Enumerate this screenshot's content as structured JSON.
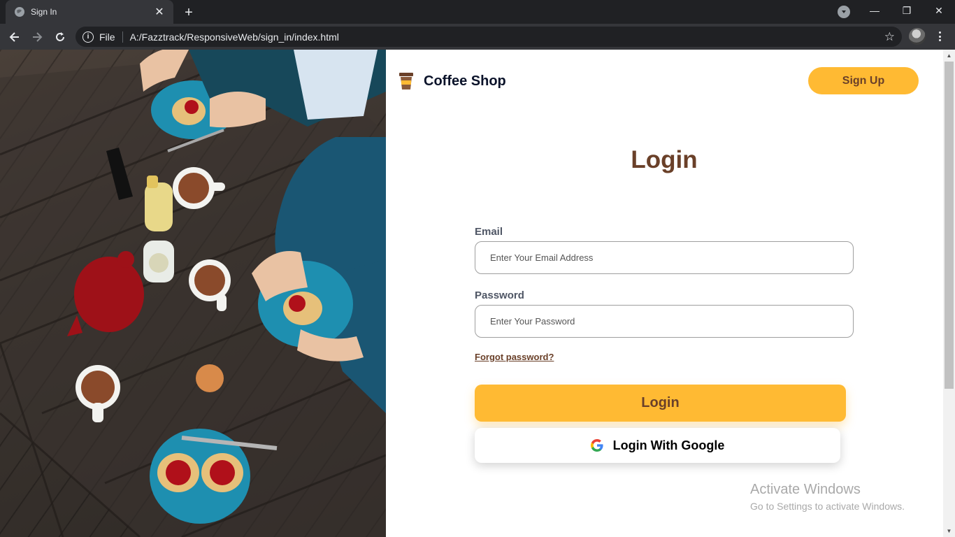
{
  "browser": {
    "tab_title": "Sign In",
    "tab_close": "✕",
    "new_tab": "+",
    "url_scheme": "File",
    "url": "A:/Fazztrack/ResponsiveWeb/sign_in/index.html",
    "window_minimize": "—",
    "window_restore": "❐",
    "window_close": "✕"
  },
  "page": {
    "brand_name": "Coffee Shop",
    "signup_label": "Sign Up",
    "title": "Login",
    "email_label": "Email",
    "email_placeholder": "Enter Your Email Address",
    "email_value": "",
    "password_label": "Password",
    "password_placeholder": "Enter Your Password",
    "password_value": "",
    "forgot_label": "Forgot password?",
    "login_label": "Login",
    "google_label": "Login With Google"
  },
  "watermark": {
    "title": "Activate Windows",
    "subtitle": "Go to Settings to activate Windows."
  },
  "colors": {
    "accent": "#ffba33",
    "brown": "#6a4029",
    "label": "#4f5665",
    "chrome_dark": "#202124",
    "chrome_mid": "#35363a"
  },
  "icons": {
    "favicon": "globe-icon",
    "back": "arrow-left-icon",
    "forward": "arrow-right-icon",
    "reload": "reload-icon",
    "info": "info-icon",
    "star": "star-icon",
    "brand": "coffee-cup-icon",
    "google": "google-icon"
  }
}
